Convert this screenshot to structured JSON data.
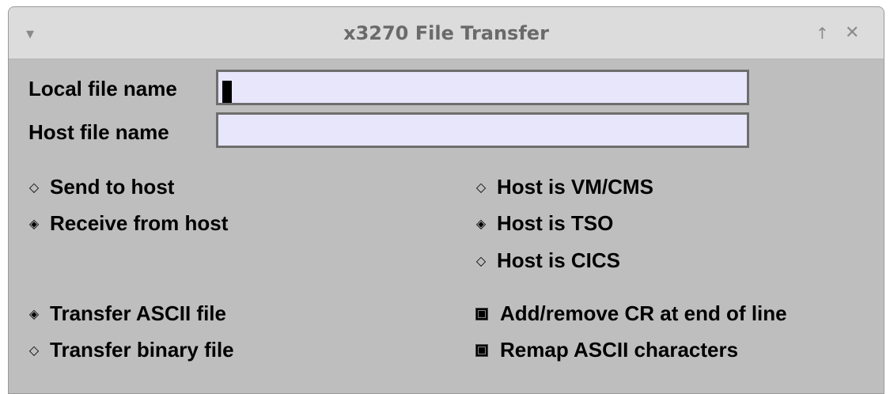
{
  "window": {
    "title": "x3270 File Transfer",
    "menu_icon": "▾",
    "maximize_icon": "↑",
    "close_icon": "✕"
  },
  "fields": {
    "local_label": "Local file name",
    "local_value": "",
    "host_label": "Host file name",
    "host_value": ""
  },
  "direction": {
    "send_label": "Send to host",
    "receive_label": "Receive from host",
    "selected": "receive"
  },
  "host_type": {
    "vm_label": "Host is VM/CMS",
    "tso_label": "Host is TSO",
    "cics_label": "Host is CICS",
    "selected": "tso"
  },
  "mode": {
    "ascii_label": "Transfer ASCII file",
    "binary_label": "Transfer binary file",
    "selected": "ascii"
  },
  "options": {
    "cr_label": "Add/remove CR at end of line",
    "cr_checked": true,
    "remap_label": "Remap ASCII characters",
    "remap_checked": true
  },
  "glyphs": {
    "radio_on": "◈",
    "radio_off": "◇"
  }
}
